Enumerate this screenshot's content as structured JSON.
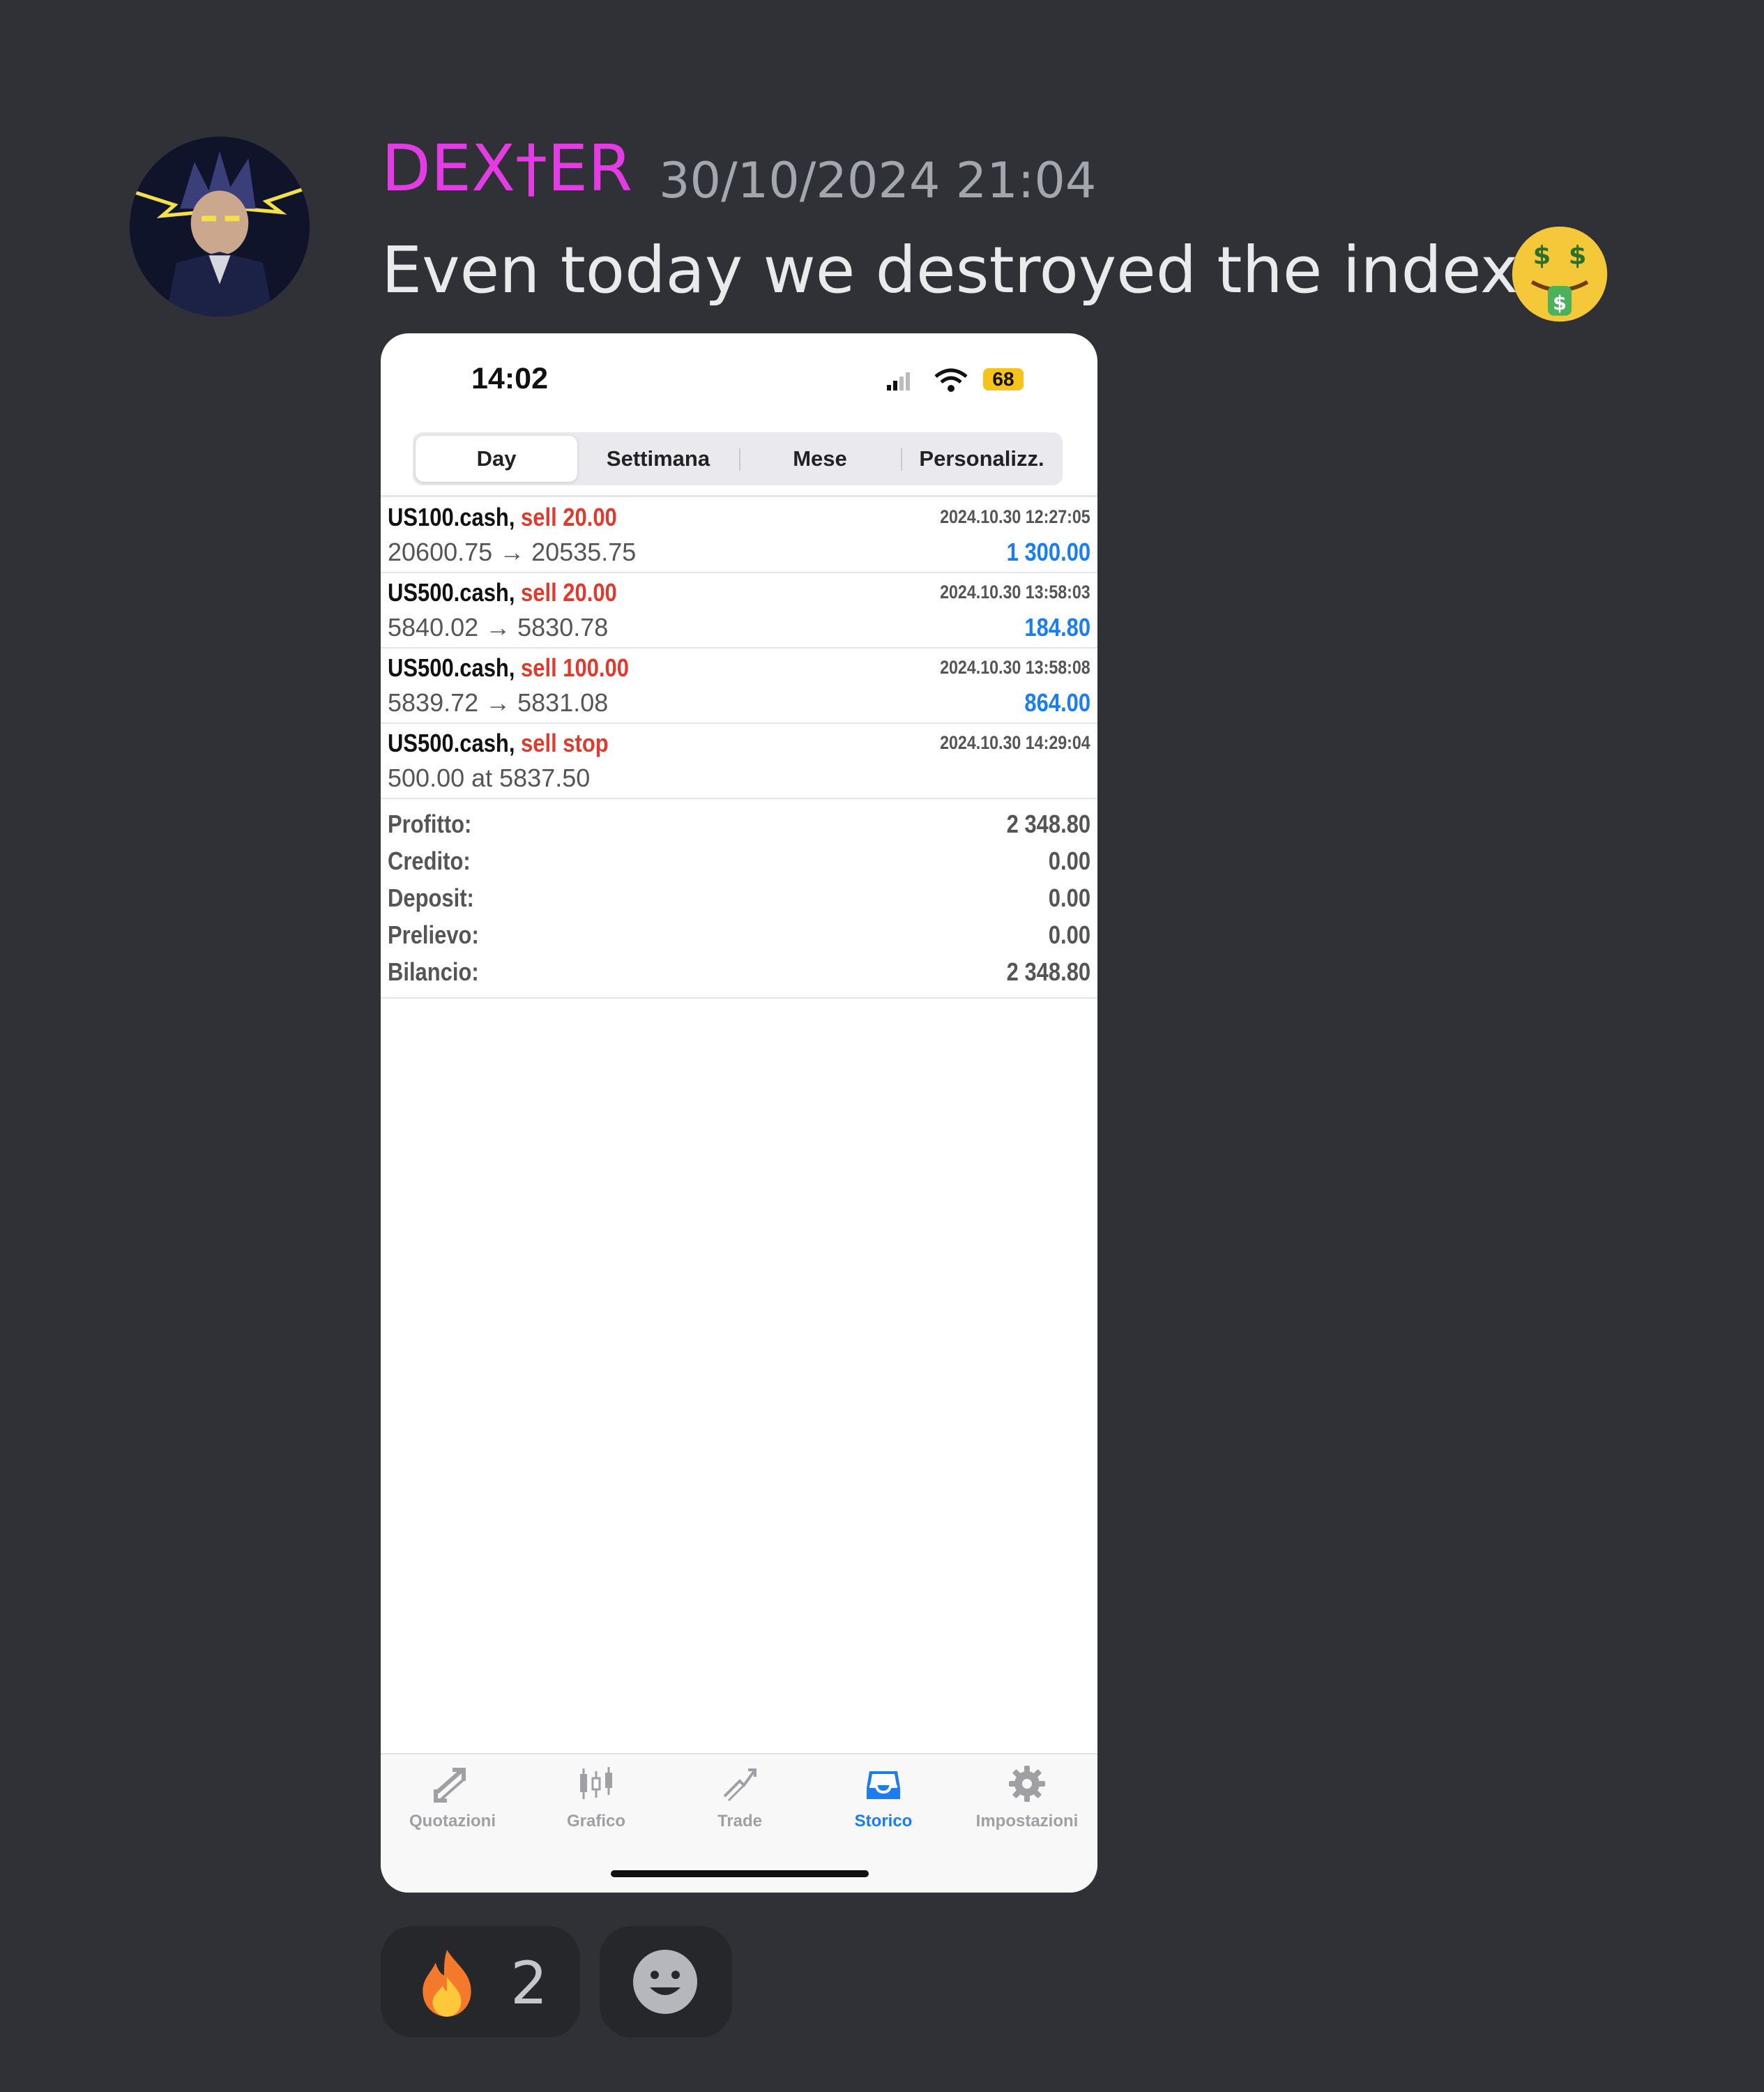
{
  "message": {
    "author": "DEX†ER",
    "timestamp": "30/10/2024 21:04",
    "text": "Even today we destroyed the indexes",
    "author_color": "#e43ce4"
  },
  "phone": {
    "status_time": "14:02",
    "battery": "68",
    "tabs": [
      {
        "label": "Day",
        "active": true
      },
      {
        "label": "Settimana",
        "active": false
      },
      {
        "label": "Mese",
        "active": false
      },
      {
        "label": "Personalizz.",
        "active": false
      }
    ],
    "trades": [
      {
        "symbol": "US100.cash,",
        "side": "sell 20.00",
        "date": "2024.10.30 12:27:05",
        "price": "20600.75 → 20535.75",
        "profit": "1 300.00"
      },
      {
        "symbol": "US500.cash,",
        "side": "sell 20.00",
        "date": "2024.10.30 13:58:03",
        "price": "5840.02 → 5830.78",
        "profit": "184.80"
      },
      {
        "symbol": "US500.cash,",
        "side": "sell 100.00",
        "date": "2024.10.30 13:58:08",
        "price": "5839.72 → 5831.08",
        "profit": "864.00"
      },
      {
        "symbol": "US500.cash,",
        "side": "sell stop",
        "date": "2024.10.30 14:29:04",
        "price": "500.00 at 5837.50",
        "profit": ""
      }
    ],
    "summary": [
      {
        "label": "Profitto:",
        "value": "2 348.80"
      },
      {
        "label": "Credito:",
        "value": "0.00"
      },
      {
        "label": "Deposit:",
        "value": "0.00"
      },
      {
        "label": "Prelievo:",
        "value": "0.00"
      },
      {
        "label": "Bilancio:",
        "value": "2 348.80"
      }
    ],
    "nav": [
      {
        "label": "Quotazioni",
        "icon": "quotes-icon",
        "active": false
      },
      {
        "label": "Grafico",
        "icon": "chart-icon",
        "active": false
      },
      {
        "label": "Trade",
        "icon": "trade-icon",
        "active": false
      },
      {
        "label": "Storico",
        "icon": "history-icon",
        "active": true
      },
      {
        "label": "Impostazioni",
        "icon": "settings-icon",
        "active": false
      }
    ],
    "accent_color": "#1a7ef0",
    "sell_color": "#e03a2f"
  },
  "reactions": [
    {
      "emoji": "fire-icon",
      "count": "2"
    }
  ]
}
